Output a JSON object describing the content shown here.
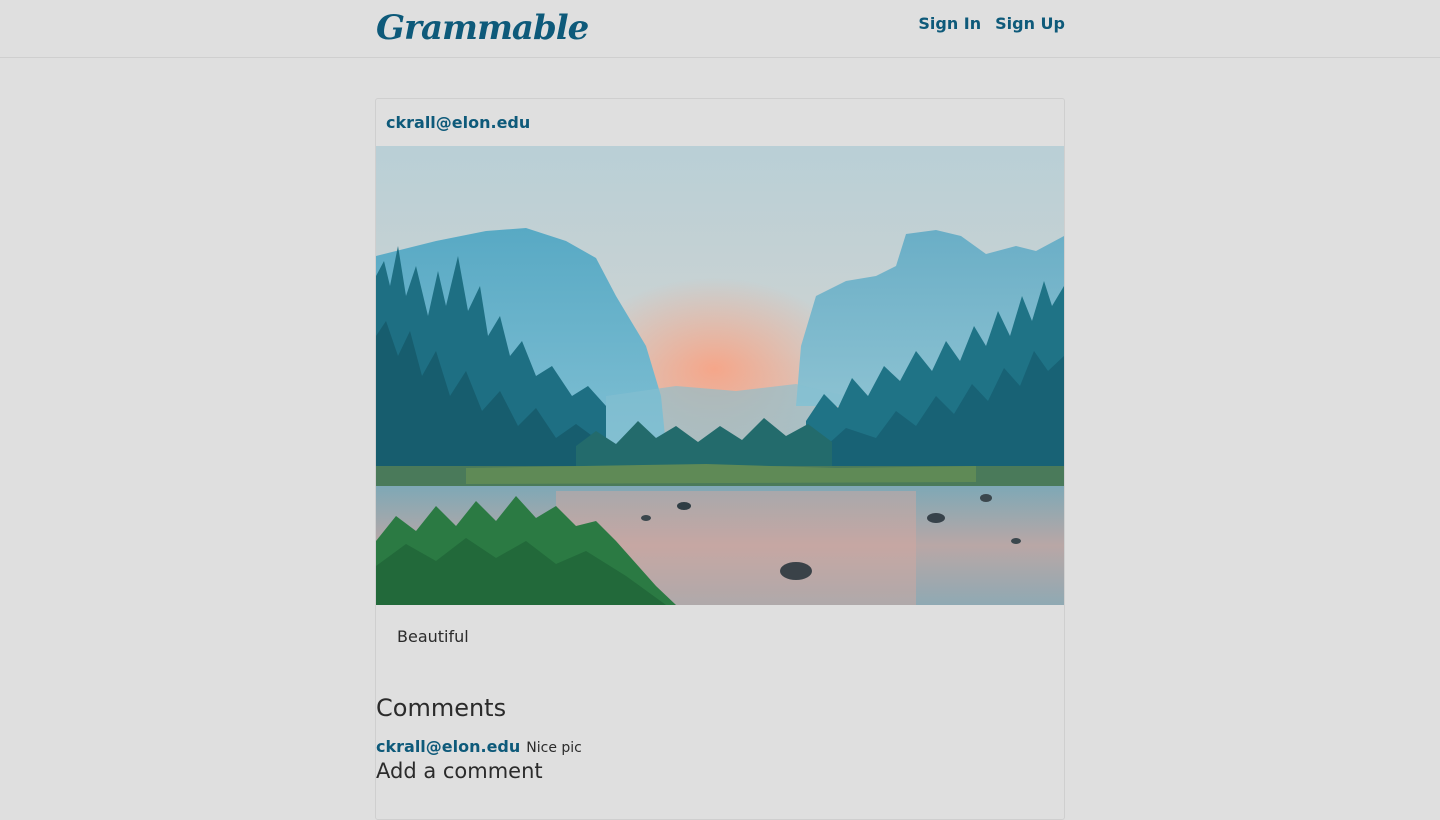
{
  "nav": {
    "brand": "Grammable",
    "sign_in": "Sign In",
    "sign_up": "Sign Up",
    "accent_color": "#0e5a7a"
  },
  "post": {
    "author": "ckrall@elon.edu",
    "photo_icon": "landscape-photo",
    "caption": "Beautiful"
  },
  "comments": {
    "title": "Comments",
    "items": [
      {
        "author": "ckrall@elon.edu",
        "text": "Nice pic"
      }
    ],
    "add_title": "Add a comment"
  }
}
